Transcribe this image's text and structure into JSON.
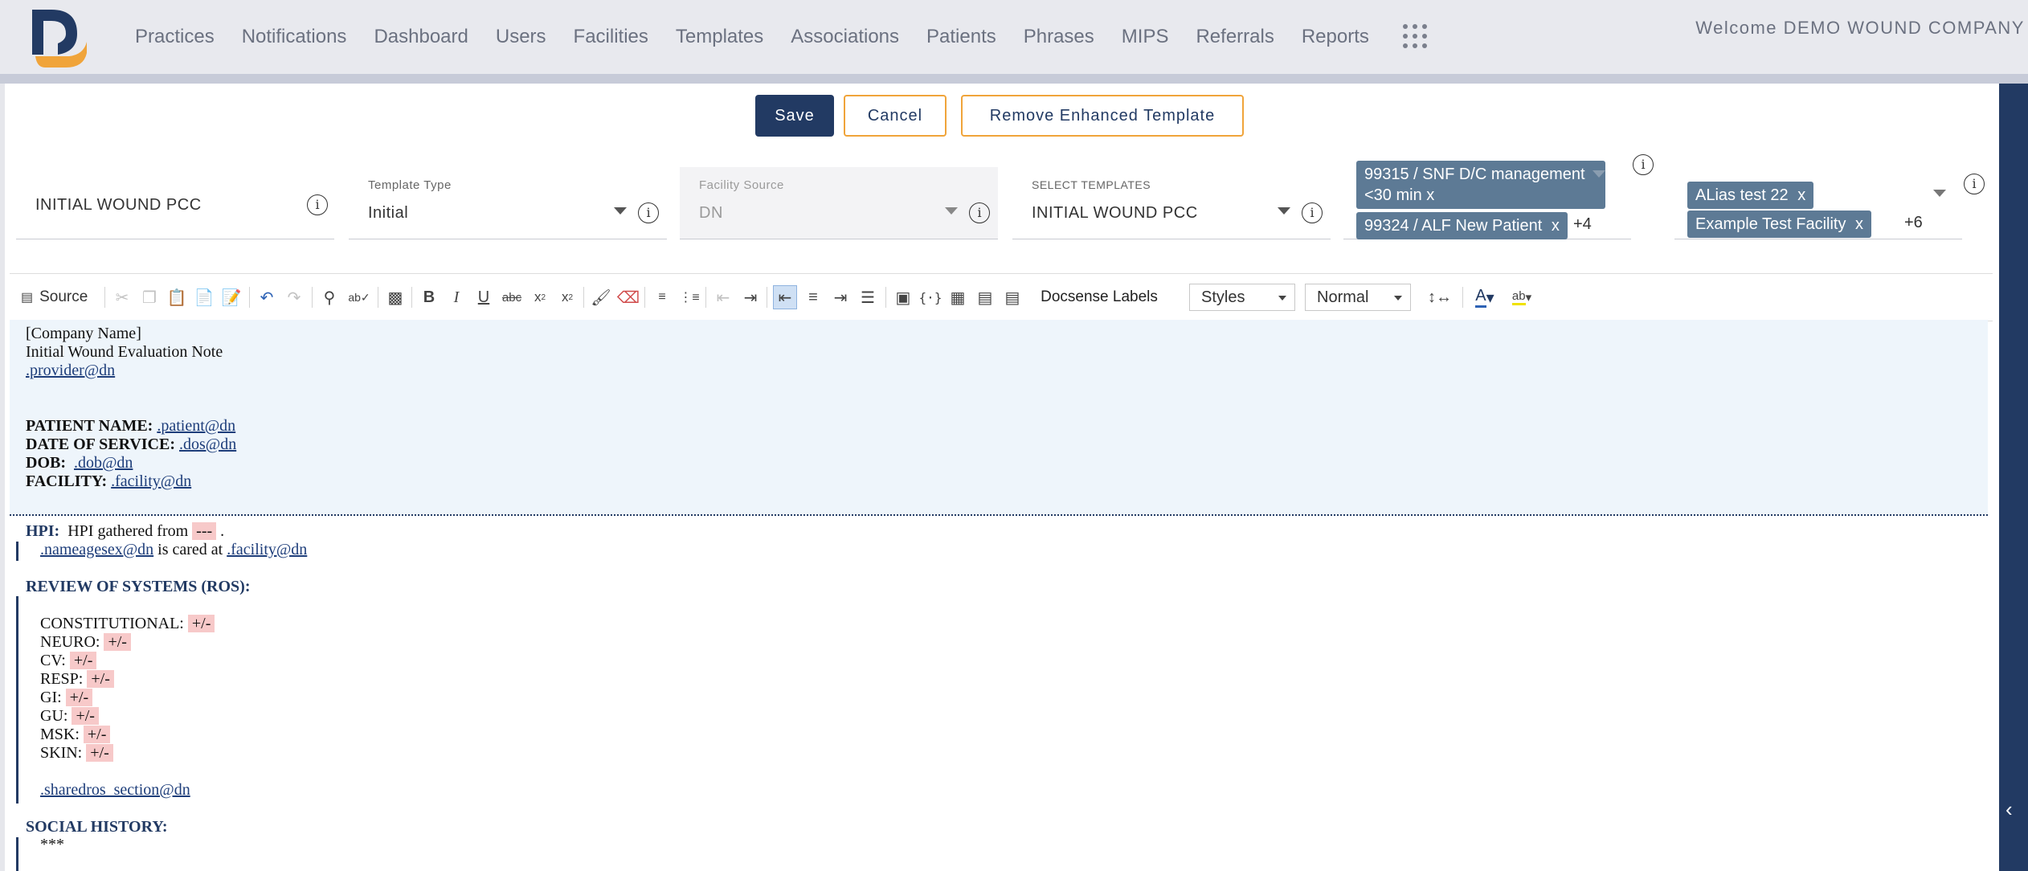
{
  "nav": {
    "items": [
      "Practices",
      "Notifications",
      "Dashboard",
      "Users",
      "Facilities",
      "Templates",
      "Associations",
      "Patients",
      "Phrases",
      "MIPS",
      "Referrals",
      "Reports"
    ],
    "welcome": "Welcome DEMO WOUND COMPANY"
  },
  "actions": {
    "save": "Save",
    "cancel": "Cancel",
    "remove": "Remove Enhanced Template"
  },
  "fields": {
    "template_name": "INITIAL WOUND PCC",
    "template_type_label": "Template Type",
    "template_type_value": "Initial",
    "facility_source_label": "Facility Source",
    "facility_source_value": "DN",
    "select_templates_label": "SELECT TEMPLATES",
    "select_templates_value": "INITIAL WOUND PCC"
  },
  "cpt_chips": [
    "99315 / SNF D/C management <30 min",
    "99324 / ALF New Patient"
  ],
  "cpt_more": "+4",
  "facility_chips": [
    "ALias test 22",
    "Example Test Facility"
  ],
  "facility_more": "+6",
  "chip_remove": "x",
  "toolbar": {
    "source": "Source",
    "docsense": "Docsense Labels",
    "styles": "Styles",
    "format": "Normal"
  },
  "doc": {
    "company": "[Company Name]",
    "title": "Initial Wound Evaluation Note",
    "provider": ".provider@dn",
    "patient_label": "PATIENT NAME:",
    "patient": ".patient@dn",
    "dos_label": "DATE OF SERVICE:",
    "dos": ".dos@dn",
    "dob_label": "DOB:",
    "dob": ".dob@dn",
    "facility_label": "FACILITY:",
    "facility": ".facility@dn",
    "hpi_label": "HPI:",
    "hpi_text": "HPI gathered from",
    "hpi_dashes": "---",
    "hpi_end": ".",
    "nameagesex": ".nameagesex@dn",
    "cared_at": "is cared at",
    "facility2": ".facility@dn",
    "ros_label": "REVIEW OF SYSTEMS (ROS):",
    "ros_items": [
      "CONSTITUTIONAL:",
      "NEURO:",
      "CV:",
      "RESP:",
      "GI:",
      "GU:",
      "MSK:",
      "SKIN:"
    ],
    "ros_value": "+/-",
    "sharedros": ".sharedros_section@dn",
    "social_label": "SOCIAL HISTORY:",
    "social_value": "***"
  }
}
